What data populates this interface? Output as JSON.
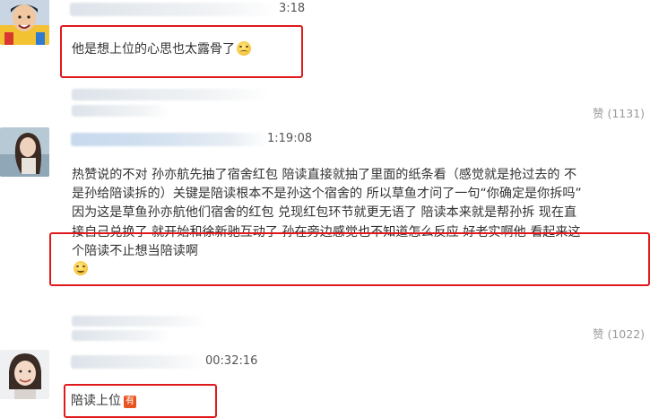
{
  "comments": [
    {
      "timestamp_fragment": "3:18",
      "text": "他是想上位的心思也太露骨了",
      "emoji_icon": "sad-face-emoji"
    },
    {
      "like_label": "赞 (1131)",
      "timestamp_fragment": "1:19:08",
      "lines": [
        "热赞说的不对 孙亦航先抽了宿舍红包 陪读直接就抽了里面的纸条看（感觉就是抢过去的 不",
        "是孙给陪读拆的）关键是陪读根本不是孙这个宿舍的 所以草鱼才问了一句“你确定是你拆吗”",
        "因为这是草鱼孙亦航他们宿舍的红包 兑现红包环节就更无语了 陪读本来就是帮孙拆 现在直",
        "接自己兑换了 就开始和徐新驰互动了 孙在旁边感觉也不知道怎么反应 好老实啊他 看起来这",
        "个陪读不止想当陪读啊"
      ],
      "emoji_icon": "grinning-sweat-emoji"
    },
    {
      "like_label": "赞 (1022)",
      "timestamp_fragment": "00:32:16",
      "text": "陪读上位",
      "badge_text": "有",
      "badge_icon": "you-badge-icon"
    }
  ],
  "colors": {
    "highlight_red": "#e0191c",
    "text": "#333333",
    "muted": "#9a9a9a"
  }
}
